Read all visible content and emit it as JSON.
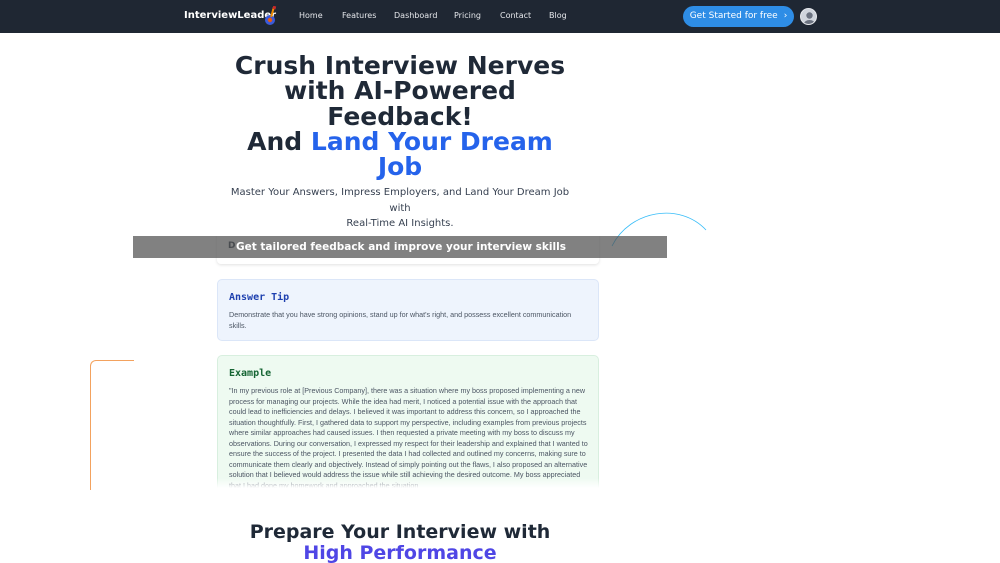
{
  "nav": {
    "brand": "InterviewLeader",
    "links": [
      "Home",
      "Features",
      "Dashboard",
      "Pricing",
      "Contact",
      "Blog"
    ],
    "cta_label": "Get Started for free",
    "cta_icon": "chevron-right-icon",
    "avatar_icon": "user-avatar-icon"
  },
  "hero": {
    "title_line1": "Crush Interview Nerves",
    "title_line2": "with AI-Powered",
    "title_line3": "Feedback!",
    "title_line4_prefix": "And",
    "title_line4_accent": "Land Your Dream",
    "title_line5_accent": "Job",
    "subtitle_line1": "Master Your Answers, Impress Employers, and Land Your Dream Job with",
    "subtitle_line2": "Real-Time AI Insights."
  },
  "demo": {
    "banner": "Get tailored feedback and improve your interview skills",
    "top_card_letter": "D",
    "tip_heading": "Answer Tip",
    "tip_body": "Demonstrate that you have strong opinions, stand up for what's right, and possess excellent communication skills.",
    "example_heading": "Example",
    "example_body": "\"In my previous role at [Previous Company], there was a situation where my boss proposed implementing a new process for managing our projects. While the idea had merit, I noticed a potential issue with the approach that could lead to inefficiencies and delays. I believed it was important to address this concern, so I approached the situation thoughtfully. First, I gathered data to support my perspective, including examples from previous projects where similar approaches had caused issues. I then requested a private meeting with my boss to discuss my observations. During our conversation, I expressed my respect for their leadership and explained that I wanted to ensure the success of the project. I presented the data I had collected and outlined my concerns, making sure to communicate them clearly and objectively. Instead of simply pointing out the flaws, I also proposed an alternative solution that I believed would address the issue while still achieving the desired outcome. My boss appreciated that I had done my homework and approached the situation"
  },
  "section2": {
    "title_line1": "Prepare Your Interview with",
    "title_line2": "High Performance"
  },
  "colors": {
    "nav_bg": "#1f2733",
    "cta_bg": "#2e8de6",
    "accent_blue": "#2563eb",
    "accent_indigo": "#4f46e5",
    "tip_bg": "#eef4fd",
    "example_bg": "#eefaf1"
  }
}
